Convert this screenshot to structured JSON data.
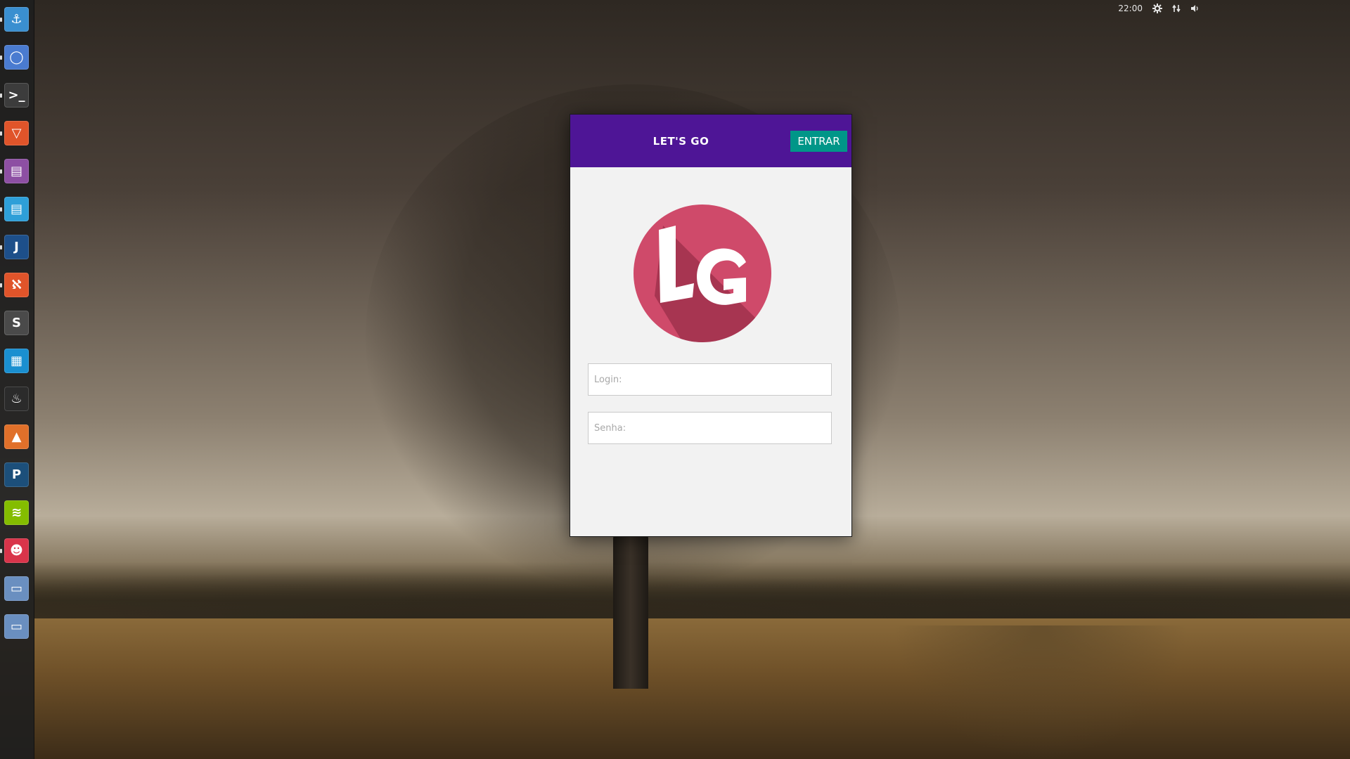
{
  "desktop": {
    "clock": "22:00",
    "indicators": [
      "gear-icon",
      "network-icon",
      "volume-icon"
    ]
  },
  "launcher": {
    "items": [
      {
        "name": "anchor-app-icon",
        "glyph": "⚓",
        "color": "#3a8fd0"
      },
      {
        "name": "chromium-icon",
        "glyph": "◯",
        "color": "#4a7bd0"
      },
      {
        "name": "terminal-icon",
        "glyph": ">_",
        "color": "#3c3c3c"
      },
      {
        "name": "software-center-icon",
        "glyph": "▽",
        "color": "#e0542a"
      },
      {
        "name": "text-editor-icon",
        "glyph": "▤",
        "color": "#8d4fa3"
      },
      {
        "name": "document-viewer-icon",
        "glyph": "▤",
        "color": "#2e9fd8"
      },
      {
        "name": "jetbrains-icon",
        "glyph": "J",
        "color": "#1d4f8a"
      },
      {
        "name": "xampp-icon",
        "glyph": "ℵ",
        "color": "#e0542a"
      },
      {
        "name": "sublime-text-icon",
        "glyph": "S",
        "color": "#4a4a4a"
      },
      {
        "name": "system-monitor-icon",
        "glyph": "▦",
        "color": "#1a8fd0"
      },
      {
        "name": "steam-icon",
        "glyph": "♨",
        "color": "#2b2b2b"
      },
      {
        "name": "vlc-icon",
        "glyph": "▲",
        "color": "#e0702a"
      },
      {
        "name": "pycharm-icon",
        "glyph": "P",
        "color": "#1c4f7a"
      },
      {
        "name": "spotify-icon",
        "glyph": "≋",
        "color": "#84bd00"
      },
      {
        "name": "game-app-icon",
        "glyph": "☻",
        "color": "#d9344a"
      },
      {
        "name": "window-icon-1",
        "glyph": "▭",
        "color": "#6a8fc0"
      },
      {
        "name": "window-icon-2",
        "glyph": "▭",
        "color": "#6a8fc0"
      }
    ]
  },
  "app": {
    "title": "LET'S GO",
    "enter_label": "ENTRAR",
    "logo_text": "LG",
    "colors": {
      "header": "#4e1596",
      "button": "#009688",
      "logo": "#cf4a6a"
    },
    "login": {
      "placeholder": "Login:",
      "value": ""
    },
    "password": {
      "placeholder": "Senha:",
      "value": ""
    }
  }
}
